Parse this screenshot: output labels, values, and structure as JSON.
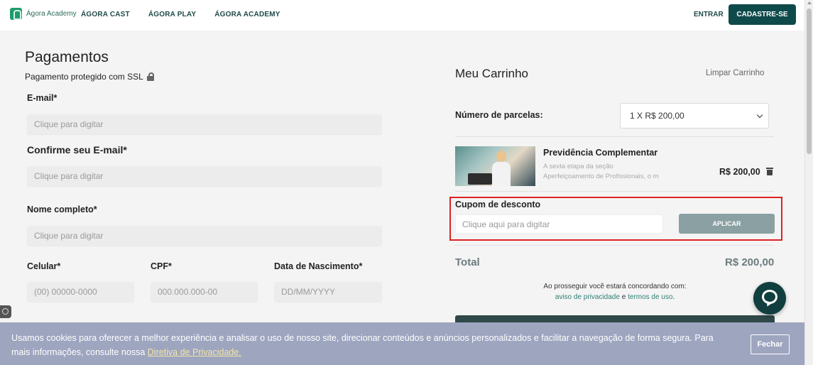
{
  "header": {
    "logo_text": "Ágora Academy",
    "nav": [
      "ÁGORA CAST",
      "ÁGORA PLAY",
      "ÁGORA ACADEMY"
    ],
    "login_label": "ENTRAR",
    "signup_label": "CADASTRE-SE"
  },
  "form": {
    "title": "Pagamentos",
    "ssl_note": "Pagamento protegido com SSL",
    "email_label": "E-mail*",
    "email_placeholder": "Clique para digitar",
    "confirm_email_label": "Confirme seu E-mail*",
    "confirm_email_placeholder": "Clique para digitar",
    "name_label": "Nome completo*",
    "name_placeholder": "Clique para digitar",
    "phone_label": "Celular*",
    "phone_placeholder": "(00) 00000-0000",
    "cpf_label": "CPF*",
    "cpf_placeholder": "000.000.000-00",
    "birth_label": "Data de Nascimento*",
    "birth_placeholder": "DD/MM/YYYY"
  },
  "cart": {
    "title": "Meu Carrinho",
    "clear_label": "Limpar Carrinho",
    "installments_label": "Número de parcelas:",
    "installments_value": "1 X R$ 200,00",
    "product": {
      "title": "Previdência Complementar",
      "desc_line1": "A sexta etapa da seção",
      "desc_line2": "Aperfeiçoamento de Profissionais, o m",
      "price": "R$ 200,00"
    },
    "coupon_label": "Cupom de desconto",
    "coupon_placeholder": "Clique aqui para digitar",
    "apply_label": "APLICAR",
    "total_label": "Total",
    "total_value": "R$ 200,00",
    "agree_text": "Ao prosseguir você estará concordando com:",
    "privacy_link": "aviso de privacidade",
    "and_text": "e",
    "terms_link": "termos de uso",
    "period": "."
  },
  "cookie": {
    "text_before": "Usamos cookies para oferecer a melhor experiência e analisar o uso de nosso site, direcionar conteúdos e anúncios personalizados e facilitar a navegação de forma segura. Para mais informações, consulte nossa ",
    "link_text": "Diretiva de Privacidade.",
    "close_label": "Fechar"
  },
  "colors": {
    "brand_dark": "#0f4a4a",
    "brand_green": "#1f9b6c",
    "apply_button": "#8aa0a3",
    "highlight_border": "#dd2222",
    "cookie_banner": "#9da5bf"
  }
}
